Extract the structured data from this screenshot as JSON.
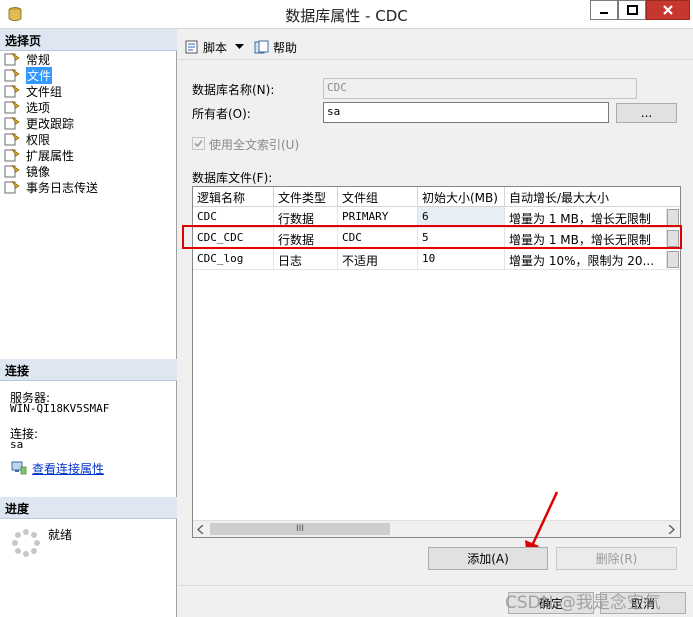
{
  "window": {
    "title": "数据库属性 - CDC"
  },
  "left": {
    "select_page_header": "选择页",
    "pages": [
      {
        "label": "常规",
        "selected": false
      },
      {
        "label": "文件",
        "selected": true
      },
      {
        "label": "文件组",
        "selected": false
      },
      {
        "label": "选项",
        "selected": false
      },
      {
        "label": "更改跟踪",
        "selected": false
      },
      {
        "label": "权限",
        "selected": false
      },
      {
        "label": "扩展属性",
        "selected": false
      },
      {
        "label": "镜像",
        "selected": false
      },
      {
        "label": "事务日志传送",
        "selected": false
      }
    ],
    "connection_header": "连接",
    "server_label": "服务器:",
    "server_value": "WIN-QI18KV5SMAF",
    "connection_label": "连接:",
    "connection_value": "sa",
    "view_conn_link": "查看连接属性",
    "progress_header": "进度",
    "progress_status": "就绪"
  },
  "toolbar": {
    "script_label": "脚本",
    "help_label": "帮助"
  },
  "form": {
    "db_name_label": "数据库名称(N):",
    "db_name_value": "CDC",
    "owner_label": "所有者(O):",
    "owner_value": "sa",
    "owner_browse": "...",
    "fulltext_label": "使用全文索引(U)",
    "files_label": "数据库文件(F):"
  },
  "grid": {
    "columns": [
      "逻辑名称",
      "文件类型",
      "文件组",
      "初始大小(MB)",
      "自动增长/最大大小"
    ],
    "rows": [
      [
        "CDC",
        "行数据",
        "PRIMARY",
        "6",
        "增量为 1 MB，增长无限制"
      ],
      [
        "CDC_CDC",
        "行数据",
        "CDC",
        "5",
        "增量为 1 MB，增长无限制"
      ],
      [
        "CDC_log",
        "日志",
        "不适用",
        "10",
        "增量为 10%，限制为 20..."
      ]
    ],
    "scroll_thumb": "III"
  },
  "buttons": {
    "add": "添加(A)",
    "remove": "删除(R)",
    "ok": "确定",
    "cancel": "取消"
  },
  "watermark": "CSDN @我是念空气",
  "colors": {
    "highlight": "#e00000",
    "selected": "#3399ff",
    "section": "#dde6f1"
  }
}
